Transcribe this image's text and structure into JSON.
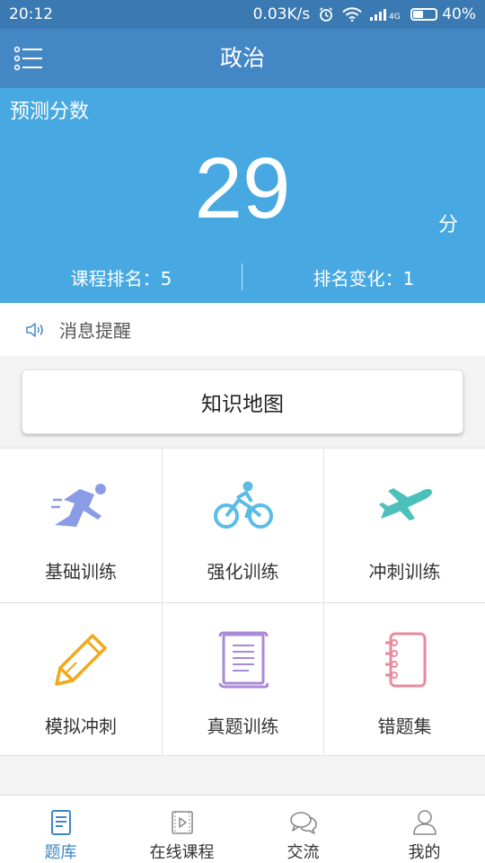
{
  "status_bar": {
    "time": "20:12",
    "speed": "0.03K/s",
    "network_label": "4G",
    "battery_percent_text": "40%",
    "battery_level": 0.4
  },
  "header": {
    "title": "政治",
    "menu_icon": "list-menu-icon"
  },
  "score_panel": {
    "label": "预测分数",
    "score": "29",
    "unit": "分",
    "rank_text": "课程排名：5",
    "change_text": "排名变化：1"
  },
  "message": {
    "icon": "speaker-icon",
    "label": "消息提醒"
  },
  "knowledge_map": {
    "label": "知识地图"
  },
  "grid": {
    "items": [
      {
        "label": "基础训练",
        "icon": "runner-icon",
        "color": "#8a9ce6"
      },
      {
        "label": "强化训练",
        "icon": "cyclist-icon",
        "color": "#5bbce6"
      },
      {
        "label": "冲刺训练",
        "icon": "airplane-icon",
        "color": "#4ec0bb"
      },
      {
        "label": "模拟冲刺",
        "icon": "pencil-icon",
        "color": "#f2a81d"
      },
      {
        "label": "真题训练",
        "icon": "scroll-icon",
        "color": "#a98ad6"
      },
      {
        "label": "错题集",
        "icon": "notebook-icon",
        "color": "#e88a9e"
      }
    ]
  },
  "bottom_nav": {
    "items": [
      {
        "label": "题库",
        "icon": "question-bank-icon",
        "active": true
      },
      {
        "label": "在线课程",
        "icon": "video-icon",
        "active": false
      },
      {
        "label": "交流",
        "icon": "chat-icon",
        "active": false
      },
      {
        "label": "我的",
        "icon": "person-icon",
        "active": false
      }
    ],
    "active_color": "#3d86c6",
    "inactive_color": "#8a8a8a"
  }
}
